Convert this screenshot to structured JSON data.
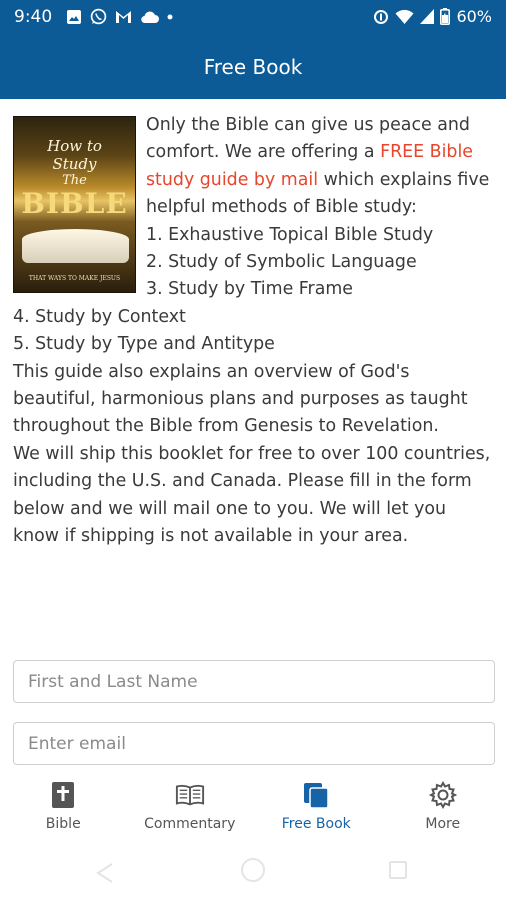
{
  "status_bar": {
    "time": "9:40",
    "battery": "60%",
    "left_icons": [
      "image-icon",
      "whatsapp-icon",
      "gmail-icon",
      "cloud-icon",
      "dot-icon"
    ],
    "right_icons": [
      "data-saver-icon",
      "wifi-icon",
      "signal-icon",
      "battery-icon"
    ]
  },
  "app_bar": {
    "title": "Free Book"
  },
  "book_cover": {
    "line1": "How to",
    "line2": "Study",
    "line3": "The",
    "line4": "BIBLE",
    "subtitle": "THAT WAYS TO MAKE JESUS"
  },
  "article": {
    "intro_before": "Only the Bible can give us peace and comfort. We are offering a ",
    "highlight": "FREE Bible study guide by mail",
    "intro_after": " which explains five helpful methods of Bible study:",
    "methods": [
      "1. Exhaustive Topical Bible Study",
      "2. Study of Symbolic Language",
      "3. Study by Time Frame",
      "4. Study by Context",
      "5. Study by Type and Antitype"
    ],
    "overview": "This guide also explains an overview of God's beautiful, harmonious plans and purposes as taught throughout the Bible from Genesis to Revelation.",
    "shipping": "We will ship this booklet for free to over 100 countries, including the U.S. and Canada. Please fill in the form below and we will mail one to you. We will let you know if shipping is not available in your area."
  },
  "form": {
    "name_placeholder": "First and Last Name",
    "email_placeholder": "Enter email"
  },
  "bottom_nav": {
    "items": [
      {
        "label": "Bible",
        "icon": "bible-icon"
      },
      {
        "label": "Commentary",
        "icon": "open-book-icon"
      },
      {
        "label": "Free Book",
        "icon": "free-book-icon",
        "active": true
      },
      {
        "label": "More",
        "icon": "gear-icon"
      }
    ]
  },
  "colors": {
    "primary": "#0c5a96",
    "highlight_red": "#e8452c",
    "active_nav": "#1763a8"
  }
}
